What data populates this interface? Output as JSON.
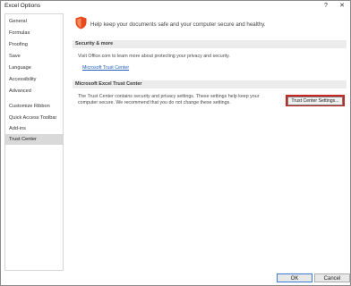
{
  "window": {
    "title": "Excel Options",
    "help_glyph": "?",
    "close_glyph": "✕"
  },
  "sidebar": {
    "items": [
      {
        "label": "General"
      },
      {
        "label": "Formulas"
      },
      {
        "label": "Proofing"
      },
      {
        "label": "Save"
      },
      {
        "label": "Language"
      },
      {
        "label": "Accessibility"
      },
      {
        "label": "Advanced"
      },
      {
        "label": "Customize Ribbon"
      },
      {
        "label": "Quick Access Toolbar"
      },
      {
        "label": "Add-ins"
      },
      {
        "label": "Trust Center",
        "active": true
      }
    ]
  },
  "main": {
    "headline": "Help keep your documents safe and your computer secure and healthy.",
    "security": {
      "header": "Security & more",
      "text": "Visit Office.com to learn more about protecting your privacy and security.",
      "link": "Microsoft Trust Center"
    },
    "trust_center": {
      "header": "Microsoft Excel Trust Center",
      "text_line1": "The Trust Center contains security and privacy settings. These settings help keep your",
      "text_line2": "computer secure. We recommend that you do not change these settings.",
      "button_label": "Trust Center Settings..."
    }
  },
  "footer": {
    "ok_label": "OK",
    "cancel_label": "Cancel"
  },
  "colors": {
    "shield": "#e8491d",
    "link": "#1f5fb8",
    "highlight_border": "#c62828",
    "active_nav": "#d9d9d9"
  }
}
